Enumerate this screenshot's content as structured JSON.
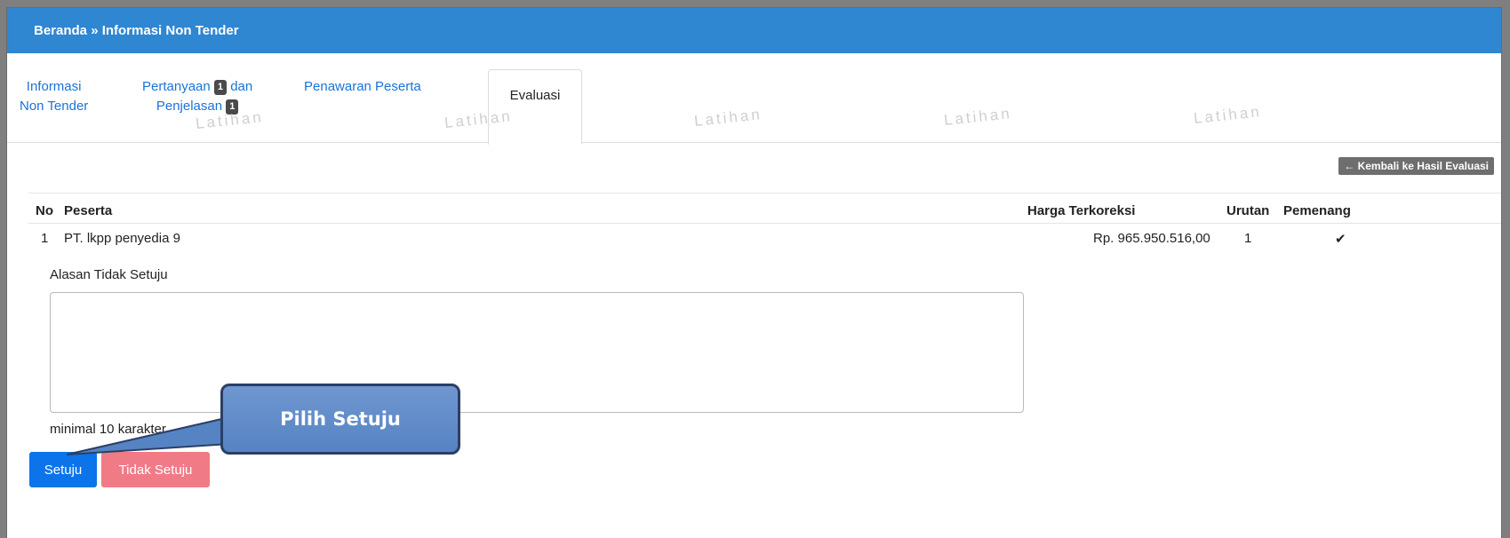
{
  "breadcrumb": "Beranda » Informasi Non Tender",
  "tabs": [
    {
      "line1": "Informasi",
      "line2": "Non Tender"
    },
    {
      "line1": "Pertanyaan",
      "badge1": "1",
      "line1_suffix": "dan",
      "line2": "Penjelasan",
      "badge2": "1"
    },
    {
      "label": "Penawaran Peserta"
    },
    {
      "label": "Evaluasi"
    }
  ],
  "watermark": "Latihan",
  "back_button": "← Kembali ke Hasil Evaluasi",
  "table": {
    "headers": {
      "no": "No",
      "peserta": "Peserta",
      "harga": "Harga Terkoreksi",
      "urutan": "Urutan",
      "pemenang": "Pemenang"
    },
    "rows": [
      {
        "no": "1",
        "peserta": "PT. lkpp penyedia 9",
        "harga": "Rp. 965.950.516,00",
        "urutan": "1",
        "pemenang": "✔"
      }
    ]
  },
  "form": {
    "reason_label": "Alasan Tidak Setuju",
    "reason_value": "",
    "help_text": "minimal 10 karakter",
    "approve_label": "Setuju",
    "reject_label": "Tidak Setuju"
  },
  "callout": "Pilih Setuju",
  "colors": {
    "header": "#2f86d1",
    "approve": "#0b74ea",
    "reject": "#f07b86",
    "callout": "#5683c4"
  }
}
